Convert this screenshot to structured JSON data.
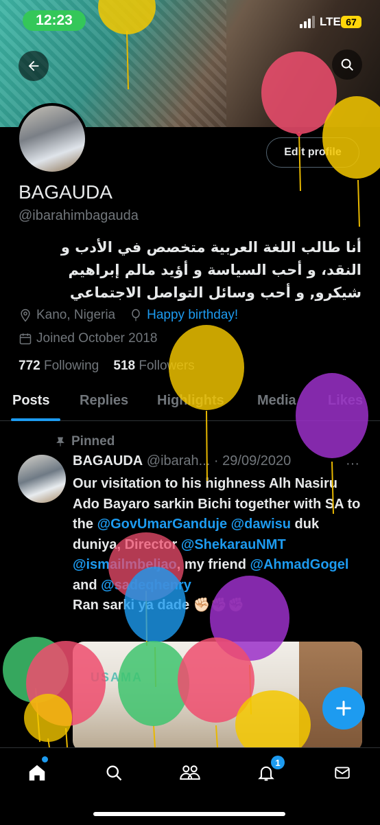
{
  "status": {
    "time": "12:23",
    "network": "LTE",
    "battery": "67"
  },
  "profile": {
    "name": "BAGAUDA",
    "handle": "@ibarahimbagauda",
    "edit_label": "Edit profile",
    "bio": "أنا طالب اللغة العربية متخصص في الأدب و النقد، و أحب السياسة و أؤيد مالم إبراهيم شيكرو, و أحب وسائل التواصل الاجتماعي",
    "location": "Kano, Nigeria",
    "birthday": "Happy birthday!",
    "joined": "Joined October 2018",
    "following_count": "772",
    "following_label": "Following",
    "followers_count": "518",
    "followers_label": "Followers"
  },
  "tabs": [
    "Posts",
    "Replies",
    "Highlights",
    "Media",
    "Likes"
  ],
  "tweet": {
    "pinned_label": "Pinned",
    "name": "BAGAUDA",
    "handle": "@ibarah...",
    "date": "· 29/09/2020",
    "more": "···",
    "text1": "Our visitation to his highness Alh Nasiru Ado Bayaro sarkin Bichi together with SA to the",
    "m1": "@GovUmarGanduje",
    "m2": "@dawisu",
    "t2": " duk duniya, Director ",
    "m3": "@ShekarauNMT",
    "m4": "@ismailmbeljao",
    "t3": ", my friend ",
    "m5": "@AhmadGogel",
    "t4": " and ",
    "m6": "@sadeqhenry",
    "t5": "Ran sarki ya dade ✊🏻✊🏿✊🏿",
    "media_logo": "USAMA"
  },
  "nav": {
    "notification_badge": "1"
  },
  "icons": [
    "back-arrow-icon",
    "search-icon",
    "location-pin-icon",
    "balloon-icon",
    "calendar-icon",
    "pin-icon",
    "plus-icon",
    "home-icon",
    "explore-search-icon",
    "communities-icon",
    "bell-icon",
    "mail-icon"
  ],
  "colors": {
    "accent": "#1d9bf0",
    "background": "#000000",
    "muted": "#71767b",
    "status_green": "#34c759",
    "battery_yellow": "#ffd60a"
  }
}
